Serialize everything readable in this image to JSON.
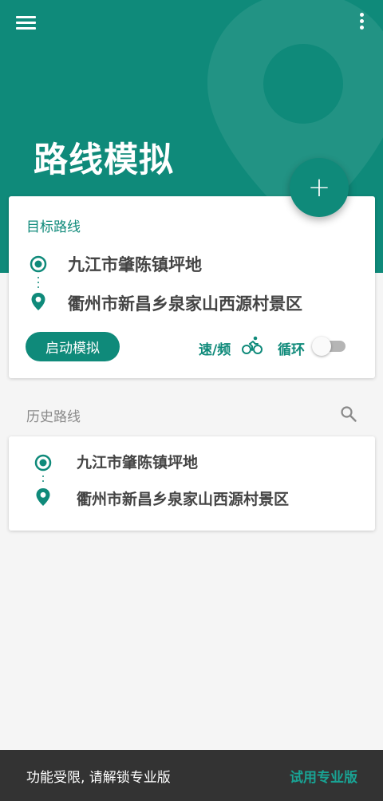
{
  "colors": {
    "primary": "#0f8a7a",
    "background": "#f5f5f5",
    "bottom_bar": "#333333",
    "bottom_accent": "#19a394"
  },
  "header": {
    "title": "路线模拟",
    "menu_icon": "hamburger-menu-icon",
    "more_icon": "more-vertical-icon",
    "fab_icon": "plus-icon",
    "fab_label": "+"
  },
  "target_route": {
    "label": "目标路线",
    "start": "九江市肇陈镇坪地",
    "end": "衢州市新昌乡泉家山西源村景区",
    "start_icon": "origin-circle-icon",
    "end_icon": "location-pin-icon",
    "start_button": "启动模拟",
    "speed_label": "速/频",
    "speed_icon": "bicycle-icon",
    "loop_label": "循环",
    "loop_enabled": false
  },
  "history": {
    "label": "历史路线",
    "search_icon": "search-icon",
    "items": [
      {
        "start": "九江市肇陈镇坪地",
        "end": "衢州市新昌乡泉家山西源村景区"
      }
    ]
  },
  "bottom_bar": {
    "message": "功能受限, 请解锁专业版",
    "action": "试用专业版"
  }
}
